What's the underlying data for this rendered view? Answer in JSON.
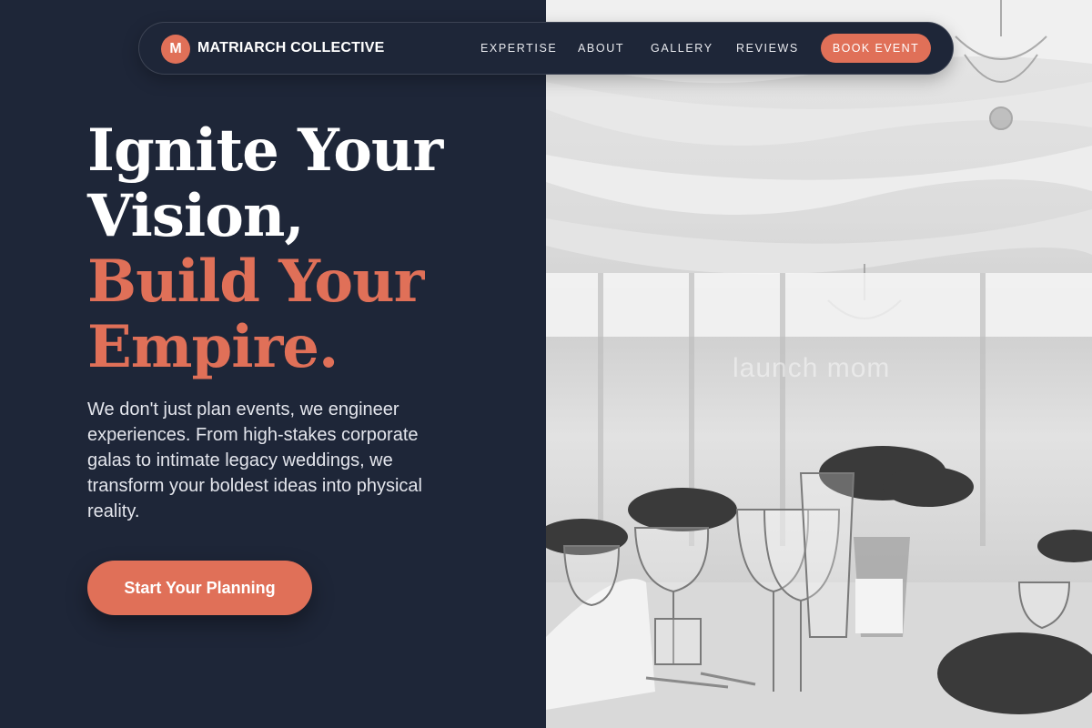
{
  "brand": {
    "logo_letter": "M",
    "name": "MATRIARCH COLLECTIVE",
    "accent_color": "#e07058",
    "background_color": "#1e2638"
  },
  "nav": {
    "links": [
      "EXPERTISE",
      "ABOUT",
      "GALLERY",
      "REVIEWS"
    ],
    "cta": "BOOK EVENT"
  },
  "hero": {
    "headline_lines_white": [
      "Ignite Your",
      "Vision,"
    ],
    "headline_lines_accent": [
      "Build Your",
      "Empire."
    ],
    "subtitle": "We don't just plan events, we engineer experiences. From high-stakes corporate galas to intimate legacy weddings, we transform your boldest ideas into physical reality.",
    "primary_button": "Start Your Planning"
  },
  "photo": {
    "watermark": "launch mom"
  }
}
